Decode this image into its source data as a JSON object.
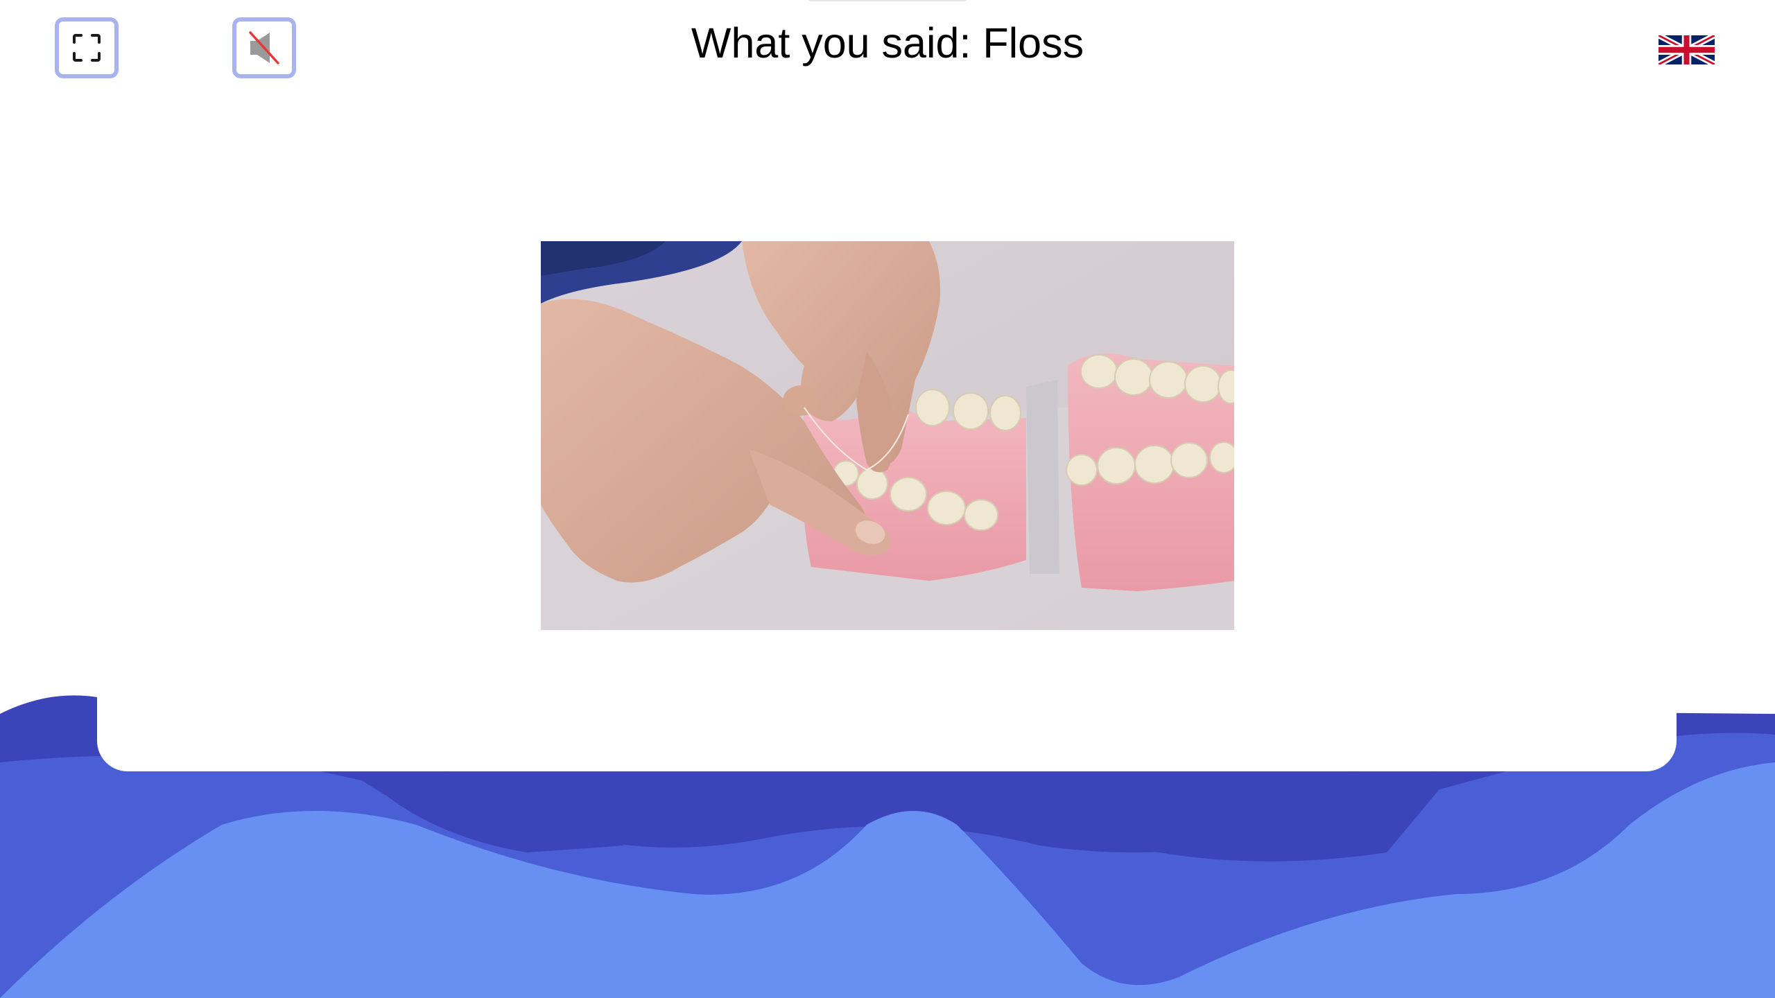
{
  "header": {
    "title": "What you said: Floss"
  },
  "controls": {
    "fullscreen_icon": "fullscreen-icon",
    "mute_icon": "speaker-muted-icon",
    "language_icon": "uk-flag-icon"
  },
  "colors": {
    "button_border": "#a9b3ee",
    "wave_dark": "#3b44b8",
    "wave_mid": "#4a5fd6",
    "wave_light": "#6790f2"
  }
}
